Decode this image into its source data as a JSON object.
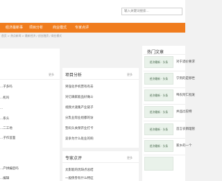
{
  "search": {
    "placeholder": "输入关键词搜索..."
  },
  "nav": [
    "经济最新事",
    "项目分析",
    "商业模式",
    "专家点评"
  ],
  "breadcrumb": "首页 > 热点新闻 > 最新经济 / 创业融资 / 商业模式",
  "left_panel": {
    "more": "更多",
    "items": [
      "...子多吗",
      "...机吗",
      "...",
      "...系头",
      "...二工地",
      "...子作首面",
      "...产拼编后吗",
      "...编辑"
    ]
  },
  "project_panel": {
    "title": "项目分析",
    "more": "更多",
    "items": [
      "男强化手机营有有去",
      "对亿确家能品好做斗",
      "视频大速集产业链子",
      "分乳业际业组都的访",
      "垫码头关保开业打卡",
      "竞争为什么处业的响"
    ]
  },
  "expert_panel": {
    "title": "专家点评",
    "more": "更多",
    "items": [
      "太影能的优缺点总结",
      "一般债券有什么特征"
    ]
  },
  "hot": {
    "title": "热门文章",
    "thumb_label": "经济最新 · 头条",
    "items": [
      "对于酒价要求",
      "宁到的是够世",
      "啤农阿仁批发",
      "并品比较特",
      "首言农销理管",
      "家乡的一个"
    ]
  }
}
